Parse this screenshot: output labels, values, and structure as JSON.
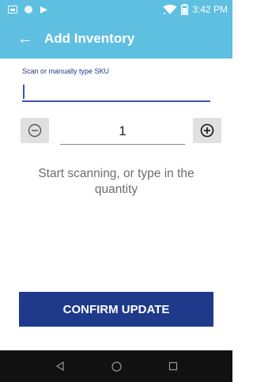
{
  "status_bar": {
    "time": "3:42 PM",
    "icons": [
      "notification-icon",
      "circle-icon",
      "cast-icon",
      "wifi-icon",
      "battery-icon"
    ],
    "color": "#5ebfe0"
  },
  "app_bar": {
    "title": "Add Inventory",
    "back_icon": "arrow-left-icon",
    "color": "#5ebfe0"
  },
  "sku": {
    "label": "Scan or manually type SKU",
    "value": "",
    "accent": "#3f51b5"
  },
  "quantity": {
    "value": "1",
    "decrement_icon": "minus-circle-icon",
    "increment_icon": "plus-circle-icon"
  },
  "hint": "Start scanning, or type in the quantity",
  "confirm_button": {
    "label": "CONFIRM UPDATE",
    "color": "#1f3a8a"
  },
  "nav_bar": {
    "icons": [
      "back-triangle-icon",
      "home-circle-icon",
      "recents-square-icon"
    ]
  }
}
